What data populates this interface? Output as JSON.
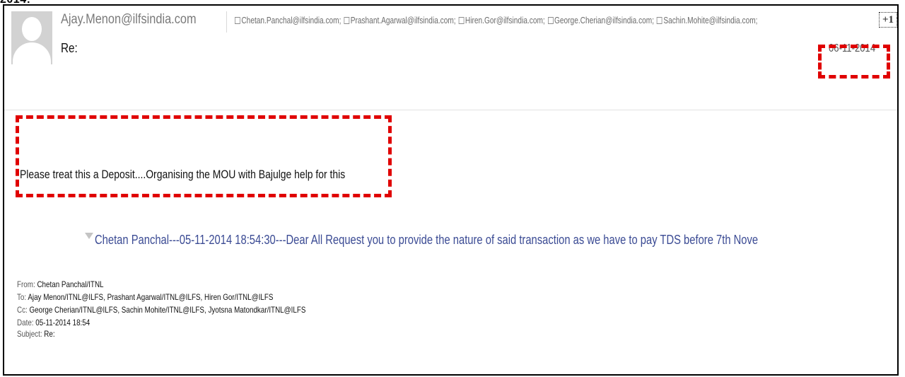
{
  "page": {
    "heading_fragment": "2014:"
  },
  "email": {
    "sender": "Ajay.Menon@ilfsindia.com",
    "recipients": [
      "Chetan.Panchal@ilfsindia.com;",
      "Prashant.Agarwal@ilfsindia.com;",
      "Hiren.Gor@ilfsindia.com;",
      "George.Cherian@ilfsindia.com;",
      "Sachin.Mohite@ilfsindia.com;"
    ],
    "more_recipients": "+1",
    "subject": "Re:",
    "date": "06-11-2014",
    "body": "Please treat this a Deposit....Organising the MOU with Bajulge help for this"
  },
  "thread": {
    "summary": "Chetan Panchal---05-11-2014 18:54:30---Dear All Request you to provide the nature of said transaction as we have to pay TDS before 7th Nove"
  },
  "quoted_header": {
    "from_label": "From:",
    "from_value": "Chetan Panchal/ITNL",
    "to_label": "To:",
    "to_value": "Ajay Menon/ITNL@ILFS, Prashant Agarwal/ITNL@ILFS, Hiren Gor/ITNL@ILFS",
    "cc_label": "Cc:",
    "cc_value": "George Cherian/ITNL@ILFS, Sachin Mohite/ITNL@ILFS, Jyotsna Matondkar/ITNL@ILFS",
    "date_label": "Date:",
    "date_value": "05-11-2014 18:54",
    "subject_label": "Subject:",
    "subject_value": "Re:"
  },
  "colors": {
    "highlight": "#e00000",
    "thread_link": "#3b4b94",
    "sender": "#7a7a7a"
  },
  "icons": {
    "avatar": "default-person-avatar",
    "checkbox": "empty-square",
    "expand": "collapse-triangle-icon"
  }
}
